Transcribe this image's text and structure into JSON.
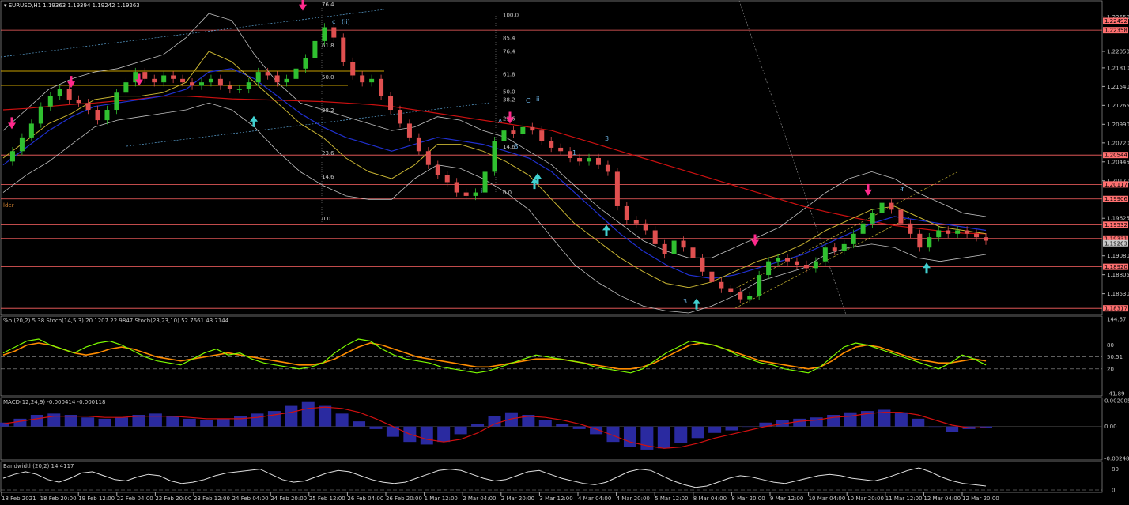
{
  "chart_data": {
    "type": "line",
    "symbol": "EURUSD,H1",
    "ohlc": "1.19363 1.19394 1.19242 1.19263",
    "price_axis": {
      "ticks": [
        "1.22550",
        "1.22050",
        "1.21810",
        "1.21540",
        "1.21265",
        "1.20990",
        "1.20720",
        "1.20445",
        "1.20170",
        "1.19625",
        "1.19080",
        "1.18805",
        "1.18530"
      ],
      "ylim": [
        1.1825,
        1.2275
      ]
    },
    "level_lines": [
      {
        "value": 1.22492,
        "label": "1.22492"
      },
      {
        "value": 1.22358,
        "label": "1.22358"
      },
      {
        "value": 1.20544,
        "label": "1.20544"
      },
      {
        "value": 1.20117,
        "label": "1.20117"
      },
      {
        "value": 1.19906,
        "label": "1.19906"
      },
      {
        "value": 1.19532,
        "label": "1.19532"
      },
      {
        "value": 1.19331,
        "label": "1.19331"
      },
      {
        "value": 1.1892,
        "label": "1.18920"
      },
      {
        "value": 1.18317,
        "label": "1.18317"
      }
    ],
    "current_price": {
      "value": 1.19263,
      "label": "1.19263"
    },
    "fib_labels": [
      "100.0",
      "85.4",
      "76.4",
      "61.8",
      "50.0",
      "38.2",
      "23.6",
      "14.6",
      "0.0"
    ],
    "fib_labels_left": [
      "76.4",
      "61.8",
      "50.0",
      "38.2",
      "23.6",
      "14.6",
      "0.0"
    ],
    "wave_labels": [
      "c",
      "(ii)",
      "A",
      "C",
      "ii",
      "B",
      "3",
      "1",
      "4",
      "i",
      "3",
      "4"
    ],
    "side_text": "lder",
    "time_axis": [
      "18 Feb 2021",
      "18 Feb 20:00",
      "19 Feb 12:00",
      "22 Feb 04:00",
      "22 Feb 20:00",
      "23 Feb 12:00",
      "24 Feb 04:00",
      "24 Feb 20:00",
      "25 Feb 12:00",
      "26 Feb 04:00",
      "26 Feb 20:00",
      "1 Mar 12:00",
      "2 Mar 04:00",
      "2 Mar 20:00",
      "3 Mar 12:00",
      "4 Mar 04:00",
      "4 Mar 20:00",
      "5 Mar 12:00",
      "8 Mar 04:00",
      "8 Mar 20:00",
      "9 Mar 12:00",
      "10 Mar 04:00",
      "10 Mar 20:00",
      "11 Mar 12:00",
      "12 Mar 04:00",
      "12 Mar 20:00"
    ],
    "close": [
      1.2045,
      1.206,
      1.208,
      1.21,
      1.2125,
      1.214,
      1.215,
      1.2135,
      1.213,
      1.212,
      1.2105,
      1.212,
      1.2145,
      1.216,
      1.2175,
      1.2165,
      1.216,
      1.217,
      1.2165,
      1.216,
      1.2155,
      1.216,
      1.2165,
      1.2155,
      1.215,
      1.215,
      1.216,
      1.2175,
      1.217,
      1.216,
      1.2165,
      1.218,
      1.2195,
      1.222,
      1.224,
      1.2225,
      1.219,
      1.217,
      1.216,
      1.2165,
      1.214,
      1.212,
      1.21,
      1.208,
      1.206,
      1.204,
      1.2025,
      1.2015,
      1.2,
      1.1995,
      1.2,
      1.203,
      1.2075,
      1.209,
      1.2085,
      1.2095,
      1.209,
      1.2075,
      1.2065,
      1.206,
      1.205,
      1.2045,
      1.205,
      1.204,
      1.203,
      1.198,
      1.196,
      1.1955,
      1.1945,
      1.1925,
      1.191,
      1.193,
      1.192,
      1.1905,
      1.1885,
      1.187,
      1.186,
      1.1855,
      1.1845,
      1.185,
      1.188,
      1.19,
      1.1905,
      1.19,
      1.1895,
      1.189,
      1.19,
      1.192,
      1.1915,
      1.1925,
      1.194,
      1.1955,
      1.197,
      1.1985,
      1.1975,
      1.1955,
      1.194,
      1.192,
      1.1935,
      1.1945,
      1.194,
      1.1945,
      1.194,
      1.1935,
      1.193
    ],
    "ma_red": [
      1.212,
      1.2122,
      1.2125,
      1.2128,
      1.213,
      1.2133,
      1.2136,
      1.214,
      1.214,
      1.2138,
      1.2136,
      1.2135,
      1.2134,
      1.2133,
      1.2132,
      1.213,
      1.2128,
      1.2125,
      1.212,
      1.2115,
      1.211,
      1.2105,
      1.21,
      1.2095,
      1.209,
      1.208,
      1.207,
      1.206,
      1.205,
      1.204,
      1.203,
      1.202,
      1.201,
      1.2,
      1.199,
      1.198,
      1.1972,
      1.1965,
      1.1958,
      1.1952,
      1.1948,
      1.1944,
      1.1941,
      1.194
    ],
    "ma_blue": [
      1.204,
      1.2065,
      1.209,
      1.211,
      1.2125,
      1.213,
      1.2135,
      1.214,
      1.215,
      1.2175,
      1.218,
      1.2165,
      1.214,
      1.2115,
      1.2095,
      1.208,
      1.207,
      1.206,
      1.207,
      1.208,
      1.2075,
      1.207,
      1.206,
      1.205,
      1.203,
      1.2,
      1.197,
      1.194,
      1.1915,
      1.1895,
      1.188,
      1.1875,
      1.188,
      1.189,
      1.19,
      1.191,
      1.1925,
      1.194,
      1.1955,
      1.1965,
      1.196,
      1.1955,
      1.195,
      1.1945
    ],
    "ma_yellow": [
      1.205,
      1.2075,
      1.21,
      1.2115,
      1.2135,
      1.214,
      1.214,
      1.2145,
      1.216,
      1.2205,
      1.219,
      1.216,
      1.213,
      1.21,
      1.208,
      1.205,
      1.203,
      1.202,
      1.204,
      1.207,
      1.207,
      1.206,
      1.2045,
      1.2025,
      1.199,
      1.1955,
      1.193,
      1.1905,
      1.1885,
      1.1868,
      1.1862,
      1.187,
      1.1885,
      1.19,
      1.191,
      1.1925,
      1.1945,
      1.196,
      1.1975,
      1.198,
      1.1965,
      1.195,
      1.1945,
      1.194
    ],
    "boll_upper": [
      1.209,
      1.212,
      1.215,
      1.2165,
      1.2175,
      1.218,
      1.219,
      1.22,
      1.2225,
      1.226,
      1.225,
      1.22,
      1.216,
      1.213,
      1.212,
      1.211,
      1.21,
      1.209,
      1.2095,
      1.211,
      1.2105,
      1.209,
      1.208,
      1.206,
      1.204,
      1.201,
      1.198,
      1.1955,
      1.193,
      1.1915,
      1.1905,
      1.1905,
      1.192,
      1.1935,
      1.195,
      1.1975,
      1.2,
      1.202,
      1.203,
      1.202,
      1.2,
      1.1985,
      1.197,
      1.1965
    ],
    "boll_lower": [
      1.2,
      1.2025,
      1.2045,
      1.207,
      1.2095,
      1.2105,
      1.211,
      1.2115,
      1.212,
      1.213,
      1.212,
      1.2095,
      1.206,
      1.203,
      1.201,
      1.1995,
      1.199,
      1.199,
      1.202,
      1.204,
      1.2035,
      1.202,
      1.2,
      1.1975,
      1.1935,
      1.1895,
      1.187,
      1.185,
      1.1835,
      1.1828,
      1.1825,
      1.1835,
      1.185,
      1.187,
      1.188,
      1.189,
      1.191,
      1.192,
      1.1925,
      1.192,
      1.1905,
      1.19,
      1.1905,
      1.191
    ],
    "sell_arrows": [
      1.2092,
      1.2152,
      1.2155,
      1.2264,
      1.21,
      1.1922,
      1.1995
    ],
    "buy_arrows": [
      1.2118,
      1.2028,
      1.2035,
      1.196,
      1.1853,
      1.1905
    ],
    "stoch_panel": {
      "label": "%b (20,2) 5.38  Stoch(14,5,3) 20.1207 22.9847  Stoch(23,23,10) 52.7661 43.7144",
      "ticks": [
        "144.57",
        "80",
        "50.51",
        "20",
        "-41.89"
      ],
      "b_pct": [
        60,
        75,
        90,
        95,
        80,
        70,
        60,
        75,
        85,
        90,
        80,
        65,
        50,
        40,
        35,
        30,
        45,
        60,
        70,
        55,
        60,
        45,
        35,
        30,
        25,
        20,
        25,
        35,
        60,
        80,
        95,
        90,
        70,
        55,
        45,
        40,
        35,
        25,
        20,
        15,
        10,
        15,
        25,
        35,
        45,
        55,
        50,
        45,
        40,
        35,
        25,
        20,
        15,
        10,
        20,
        40,
        60,
        75,
        90,
        85,
        80,
        70,
        55,
        45,
        35,
        30,
        20,
        15,
        10,
        25,
        50,
        75,
        85,
        80,
        70,
        60,
        50,
        40,
        30,
        20,
        35,
        55,
        45,
        30
      ],
      "slow_stoch": [
        55,
        65,
        80,
        85,
        80,
        70,
        60,
        55,
        60,
        70,
        75,
        70,
        60,
        50,
        45,
        40,
        45,
        50,
        55,
        60,
        55,
        50,
        45,
        40,
        35,
        30,
        30,
        35,
        45,
        60,
        75,
        85,
        80,
        70,
        60,
        50,
        45,
        40,
        35,
        30,
        25,
        25,
        30,
        35,
        40,
        45,
        45,
        45,
        40,
        35,
        30,
        25,
        20,
        20,
        25,
        35,
        50,
        65,
        80,
        85,
        80,
        70,
        60,
        50,
        40,
        35,
        30,
        25,
        20,
        25,
        40,
        60,
        75,
        80,
        75,
        65,
        55,
        45,
        40,
        35,
        35,
        40,
        45,
        40
      ]
    },
    "macd_panel": {
      "label": "MACD(12,24,9) -0.000414 -0.000118",
      "ticks": [
        "0.002005",
        "0.00",
        "-0.00248"
      ],
      "hist": [
        0.0003,
        0.0006,
        0.0009,
        0.001,
        0.0009,
        0.0007,
        0.0006,
        0.0007,
        0.0009,
        0.001,
        0.0008,
        0.0006,
        0.0005,
        0.0006,
        0.0008,
        0.001,
        0.0012,
        0.0016,
        0.0019,
        0.0016,
        0.001,
        0.0004,
        -0.0002,
        -0.0008,
        -0.0012,
        -0.0014,
        -0.0012,
        -0.0006,
        0.0002,
        0.0008,
        0.0011,
        0.0009,
        0.0005,
        0.0002,
        -0.0002,
        -0.0006,
        -0.0012,
        -0.0016,
        -0.0018,
        -0.0017,
        -0.0013,
        -0.0009,
        -0.0005,
        -0.0003,
        0.0,
        0.0003,
        0.0005,
        0.0006,
        0.0007,
        0.0009,
        0.0011,
        0.0012,
        0.0013,
        0.0011,
        0.0006,
        0.0,
        -0.0004,
        -0.0002,
        -0.0001
      ],
      "signal": [
        0.0002,
        0.0004,
        0.0006,
        0.0008,
        0.0008,
        0.0008,
        0.0007,
        0.0007,
        0.0008,
        0.0008,
        0.0008,
        0.0007,
        0.0006,
        0.0006,
        0.0006,
        0.0007,
        0.0009,
        0.0011,
        0.0014,
        0.0015,
        0.0014,
        0.0011,
        0.0006,
        0.0,
        -0.0006,
        -0.001,
        -0.0012,
        -0.001,
        -0.0005,
        0.0002,
        0.0006,
        0.0008,
        0.0007,
        0.0005,
        0.0002,
        -0.0002,
        -0.0007,
        -0.0012,
        -0.0015,
        -0.0017,
        -0.0016,
        -0.0013,
        -0.0009,
        -0.0006,
        -0.0003,
        0.0,
        0.0002,
        0.0004,
        0.0005,
        0.0007,
        0.0008,
        0.001,
        0.0011,
        0.0011,
        0.0009,
        0.0005,
        0.0001,
        -0.0001,
        -0.0001
      ]
    },
    "bandwidth_panel": {
      "label": "Bandwidth(20,2) 14.4117",
      "ticks": [
        "80",
        "0"
      ],
      "values": [
        45,
        60,
        70,
        60,
        40,
        30,
        45,
        65,
        70,
        55,
        40,
        35,
        50,
        60,
        55,
        35,
        25,
        30,
        40,
        55,
        65,
        70,
        75,
        80,
        60,
        40,
        30,
        35,
        50,
        65,
        75,
        70,
        55,
        40,
        30,
        25,
        30,
        45,
        60,
        75,
        80,
        75,
        60,
        45,
        35,
        40,
        55,
        70,
        75,
        60,
        45,
        35,
        25,
        20,
        30,
        50,
        70,
        80,
        75,
        55,
        35,
        20,
        10,
        15,
        30,
        45,
        55,
        50,
        40,
        30,
        25,
        35,
        45,
        55,
        60,
        55,
        45,
        40,
        35,
        45,
        60,
        75,
        85,
        70,
        50,
        35,
        25,
        20,
        15
      ]
    },
    "colors": {
      "background": "#000000",
      "level_line": "#ff6464",
      "ma_red": "#cc1010",
      "ma_blue": "#2030d0",
      "ma_yellow": "#c8b432",
      "bollinger": "#c0c0c0",
      "candle_bull": "#30c030",
      "candle_bear": "#e05050",
      "sell_arrow": "#ff2a8c",
      "buy_arrow": "#40d0d0",
      "stoch_green": "#7cfc00",
      "stoch_orange": "#ff8c00",
      "macd_hist": "#2a2aa0",
      "macd_signal": "#d01010",
      "bandwidth": "#e0e0e0"
    }
  }
}
